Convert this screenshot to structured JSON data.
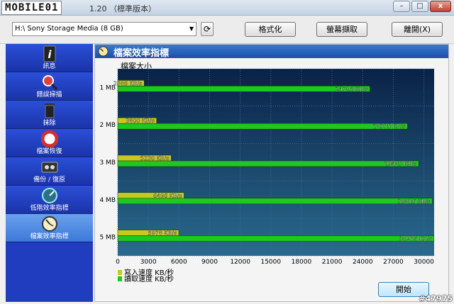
{
  "window": {
    "logo": "MOBILE01",
    "title": "1.20 （標準版本）",
    "min": "–",
    "max": "□",
    "close": "x"
  },
  "toolbar": {
    "drive": "H:\\ Sony    Storage Media (8 GB)",
    "format_label": "格式化",
    "capture_label": "螢幕擷取",
    "exit_label": "離開(X)"
  },
  "sidebar": {
    "items": [
      {
        "label": "訊息",
        "icon": "info-icon"
      },
      {
        "label": "錯誤掃描",
        "icon": "magnifier-icon"
      },
      {
        "label": "抹除",
        "icon": "trash-icon"
      },
      {
        "label": "檔案恢復",
        "icon": "lifebuoy-icon"
      },
      {
        "label": "備份 / 復原",
        "icon": "tape-icon"
      },
      {
        "label": "低階效率指標",
        "icon": "gauge-icon"
      },
      {
        "label": "檔案效率指標",
        "icon": "clock-icon"
      }
    ],
    "active_index": 6
  },
  "panel": {
    "title": "檔案效率指標",
    "start_label": "開始"
  },
  "chart_data": {
    "type": "bar",
    "orientation": "horizontal",
    "ylabel": "檔案大小",
    "categories": [
      "1 MB",
      "2 MB",
      "3 MB",
      "4 MB",
      "5 MB"
    ],
    "series": [
      {
        "name": "寫入速度 KB/秒",
        "color": "#c8c81e",
        "values": [
          2586,
          3800,
          5230,
          6496,
          5978
        ],
        "labels": [
          "2586 KB/s",
          "3800 KB/s",
          "5230 KB/s",
          "6496 KB/s",
          "5978 KB/s"
        ]
      },
      {
        "name": "讀取速度 KB/秒",
        "color": "#1ec81e",
        "values": [
          24704,
          28375,
          29485,
          30816,
          30975
        ],
        "labels": [
          "24704 KB/s",
          "28375 KB/s",
          "29485 KB/s",
          "30816 KB/s",
          "30975 KB/s"
        ]
      }
    ],
    "xticks": [
      0,
      3000,
      6000,
      9000,
      12000,
      15000,
      18000,
      21000,
      24000,
      27000,
      30000
    ],
    "xlim": [
      0,
      31000
    ],
    "grid": true,
    "legend": "bottom-left",
    "background": "#0d2a55"
  },
  "watermark": "#47975"
}
